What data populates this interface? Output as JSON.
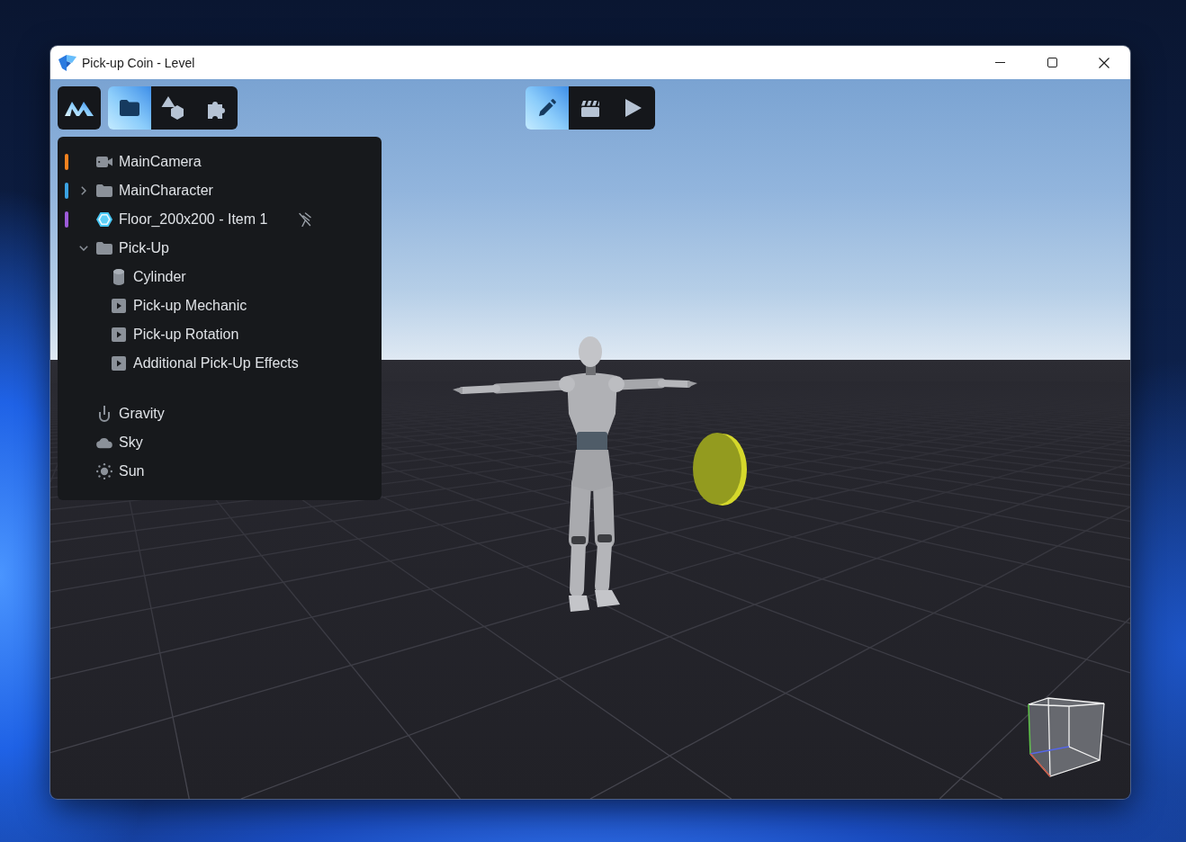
{
  "window": {
    "title": "Pick-up Coin - Level"
  },
  "panel_tabs": [
    {
      "kind": "folder",
      "selected": true
    },
    {
      "kind": "shapes",
      "selected": false
    },
    {
      "kind": "puzzle",
      "selected": false
    }
  ],
  "mode_tabs": [
    {
      "kind": "edit",
      "selected": true
    },
    {
      "kind": "cinematic",
      "selected": false
    },
    {
      "kind": "play",
      "selected": false
    }
  ],
  "hierarchy": {
    "items": [
      {
        "label": "MainCamera",
        "kind": "camera",
        "color": "#f5821f"
      },
      {
        "label": "MainCharacter",
        "kind": "folder",
        "color": "#3ba3e3",
        "expanded": false
      },
      {
        "label": "Floor_200x200 - Item 1",
        "kind": "mesh",
        "color": "#9d5bd8",
        "unpinned": true
      },
      {
        "label": "Pick-Up",
        "kind": "folder",
        "expanded": true,
        "children": [
          {
            "label": "Cylinder",
            "kind": "cylinder"
          },
          {
            "label": "Pick-up Mechanic",
            "kind": "script"
          },
          {
            "label": "Pick-up Rotation",
            "kind": "script"
          },
          {
            "label": "Additional Pick-Up Effects",
            "kind": "script"
          }
        ]
      }
    ],
    "environment": [
      {
        "label": "Gravity",
        "kind": "gravity"
      },
      {
        "label": "Sky",
        "kind": "sky"
      },
      {
        "label": "Sun",
        "kind": "sun"
      }
    ]
  }
}
